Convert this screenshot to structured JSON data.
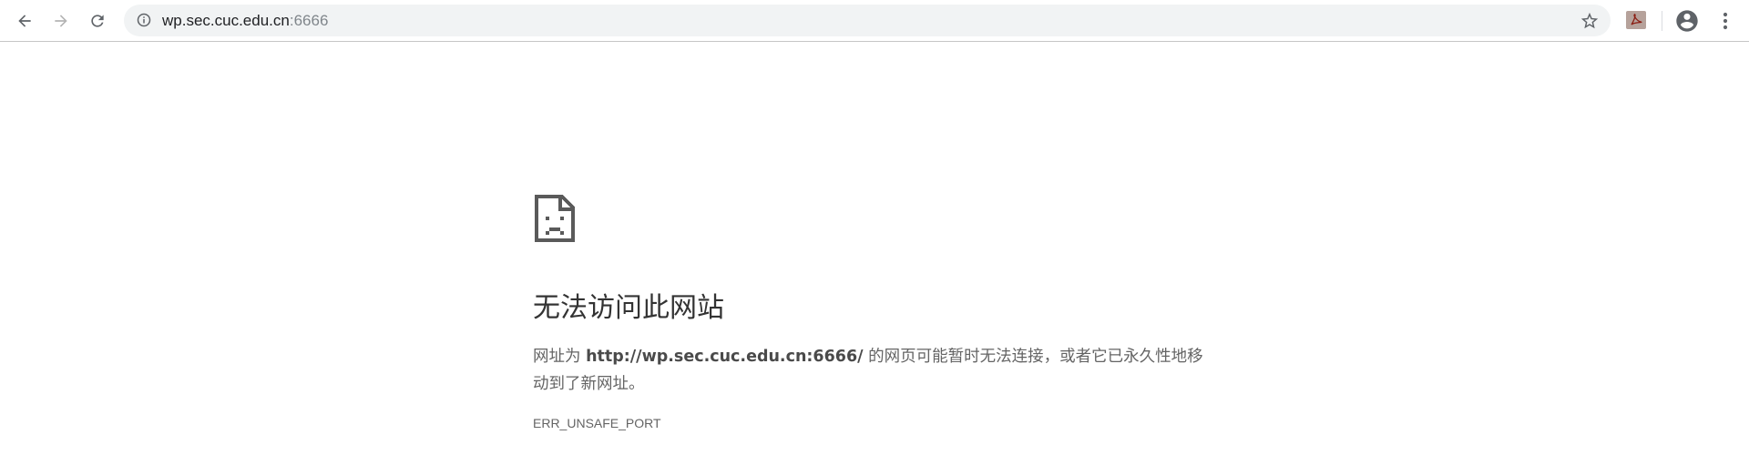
{
  "browser": {
    "back_icon": "arrow-left-icon",
    "forward_icon": "arrow-right-icon",
    "reload_icon": "reload-icon",
    "address_bar": {
      "info_icon": "info-icon",
      "url_host": "wp.sec.cuc.edu.cn",
      "url_port": ":6666",
      "bookmark_icon": "star-icon"
    },
    "extension_icon": "pdf-extension-icon",
    "profile_icon": "account-circle-icon",
    "menu_icon": "three-dots-vertical-icon"
  },
  "error_page": {
    "icon": "sad-page-icon",
    "title": "无法访问此网站",
    "desc_prefix": "网址为 ",
    "desc_url": "http://wp.sec.cuc.edu.cn:6666/",
    "desc_suffix": " 的网页可能暂时无法连接，或者它已永久性地移动到了新网址。",
    "error_code": "ERR_UNSAFE_PORT"
  },
  "colors": {
    "toolbar_bg": "#ffffff",
    "omnibox_bg": "#f1f3f4",
    "title_text": "#333333",
    "body_text": "#646464",
    "icon_gray": "#5f6368"
  }
}
